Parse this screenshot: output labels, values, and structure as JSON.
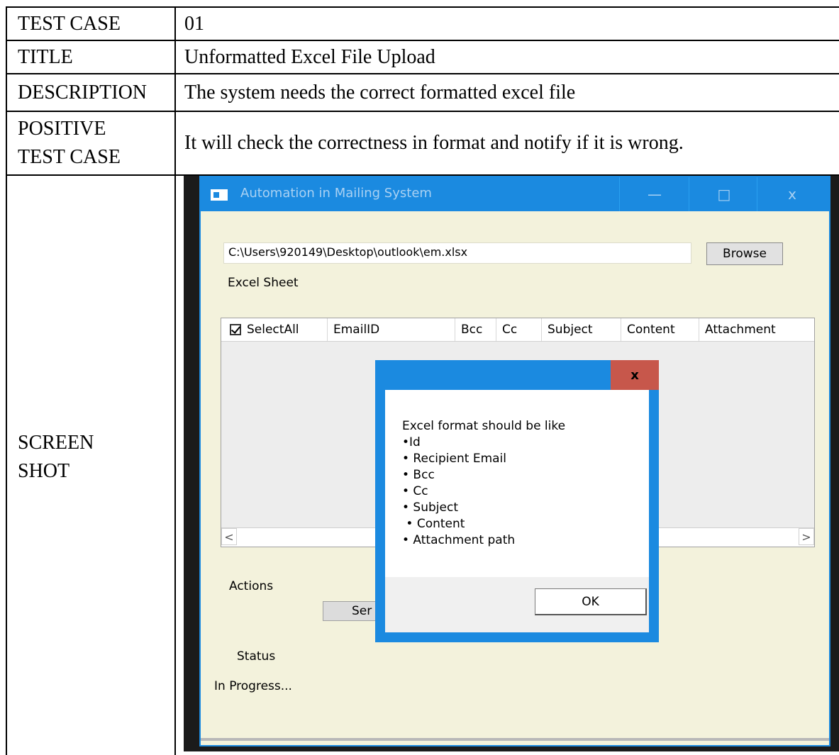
{
  "rows": [
    {
      "label": "TEST CASE",
      "value": "01"
    },
    {
      "label": "TITLE",
      "value": "Unformatted Excel File Upload"
    },
    {
      "label": "DESCRIPTION",
      "value": "The system needs the correct formatted excel file"
    },
    {
      "label_line1": "POSITIVE",
      "label_line2": "TEST CASE",
      "value": "It will check the correctness in format and notify if it is wrong."
    },
    {
      "label_line1": "SCREEN",
      "label_line2": "SHOT"
    }
  ],
  "app": {
    "window_title": "Automation in Mailing System",
    "minimize": "—",
    "maximize": "□",
    "close": "x",
    "file_path": "C:\\Users\\920149\\Desktop\\outlook\\em.xlsx",
    "browse_label": "Browse",
    "excel_sheet_label": "Excel Sheet",
    "columns": [
      "SelectAll",
      "EmailID",
      "Bcc",
      "Cc",
      "Subject",
      "Content",
      "Attachment"
    ],
    "scroll_left": "<",
    "scroll_right": ">",
    "actions_label": "Actions",
    "send_label": "Ser",
    "status_label": "Status",
    "status_value": "In Progress..."
  },
  "dialog": {
    "close": "x",
    "message": "Excel format should be like\n•Id\n• Recipient Email\n• Bcc\n• Cc\n• Subject\n • Content\n• Attachment path",
    "ok_label": "OK"
  }
}
